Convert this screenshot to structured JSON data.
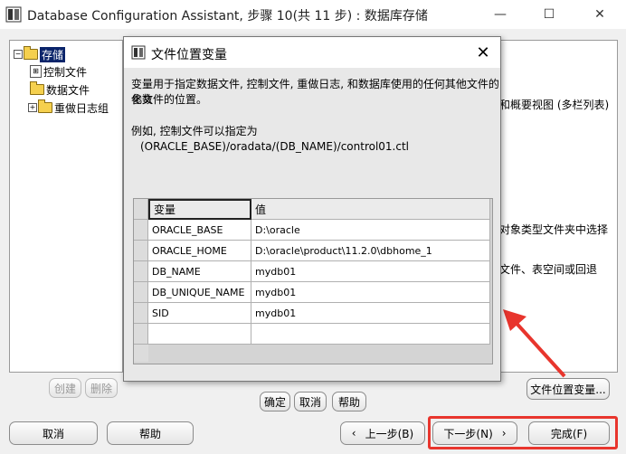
{
  "window": {
    "title": "Database Configuration Assistant, 步骤 10(共 11 步) : 数据库存储",
    "minimize": "—",
    "maximize": "☐",
    "close": "✕"
  },
  "tree": {
    "root": "存储",
    "items": [
      "控制文件",
      "数据文件",
      "重做日志组"
    ]
  },
  "right_panel": {
    "line1": "和概要视图 (多栏列表)",
    "line2": "对象类型文件夹中选择",
    "line3": "文件、表空间或回退"
  },
  "left_buttons": {
    "create": "创建",
    "delete": "删除"
  },
  "file_location_button": "文件位置变量...",
  "bottom": {
    "cancel": "取消",
    "help": "帮助",
    "back": "上一步(B)",
    "next": "下一步(N)",
    "finish": "完成(F)"
  },
  "dialog": {
    "title": "文件位置变量",
    "desc_line1": "变量用于指定数据文件, 控制文件, 重做日志, 和数据库使用的任何其他文件的参数",
    "desc_line2": "化文件的位置。",
    "example_line1": "例如, 控制文件可以指定为",
    "example_line2": "(ORACLE_BASE)/oradata/(DB_NAME)/control01.ctl",
    "columns": [
      "变量",
      "值"
    ],
    "rows": [
      {
        "name": "ORACLE_BASE",
        "value": "D:\\oracle"
      },
      {
        "name": "ORACLE_HOME",
        "value": "D:\\oracle\\product\\11.2.0\\dbhome_1"
      },
      {
        "name": "DB_NAME",
        "value": "mydb01"
      },
      {
        "name": "DB_UNIQUE_NAME",
        "value": "mydb01"
      },
      {
        "name": "SID",
        "value": "mydb01"
      }
    ],
    "ok": "确定",
    "cancel": "取消",
    "help": "帮助"
  },
  "colors": {
    "highlight": "#e8352d",
    "selection": "#0a246a"
  }
}
